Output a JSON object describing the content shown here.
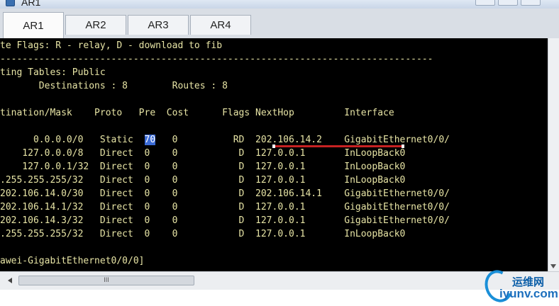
{
  "window": {
    "title": "AR1"
  },
  "tabs": [
    {
      "label": "AR1",
      "active": true
    },
    {
      "label": "AR2",
      "active": false
    },
    {
      "label": "AR3",
      "active": false
    },
    {
      "label": "AR4",
      "active": false
    }
  ],
  "terminal": {
    "lines": [
      "te Flags: R - relay, D - download to fib",
      "------------------------------------------------------------------------------",
      "ting Tables: Public",
      "       Destinations : 8        Routes : 8",
      "",
      "tination/Mask    Proto   Pre  Cost      Flags NextHop         Interface",
      "",
      "      0.0.0.0/0   Static  ",
      "    127.0.0.0/8   Direct  0    0           D  127.0.0.1       InLoopBack0",
      "    127.0.0.1/32  Direct  0    0           D  127.0.0.1       InLoopBack0",
      ".255.255.255/32   Direct  0    0           D  127.0.0.1       InLoopBack0",
      "202.106.14.0/30   Direct  0    0           D  202.106.14.1    GigabitEthernet0/0/",
      "202.106.14.1/32   Direct  0    0           D  127.0.0.1       GigabitEthernet0/0/",
      "202.106.14.3/32   Direct  0    0           D  127.0.0.1       GigabitEthernet0/0/",
      ".255.255.255/32   Direct  0    0           D  127.0.0.1       InLoopBack0",
      "",
      "awei-GigabitEthernet0/0/0]"
    ],
    "highlight_pre": "70",
    "highlight_rest": "   0          RD  202.106.14.2    GigabitEthernet0/0/"
  },
  "scrollbar": {
    "thumb_grip": "III"
  },
  "watermark": {
    "brand_cn": "运维网",
    "domain": "iyunv.com"
  },
  "colors": {
    "terminal_bg": "#000000",
    "terminal_text": "#e7e4a5",
    "selection": "#3b6bd6",
    "annotation_underline": "#c72222"
  }
}
